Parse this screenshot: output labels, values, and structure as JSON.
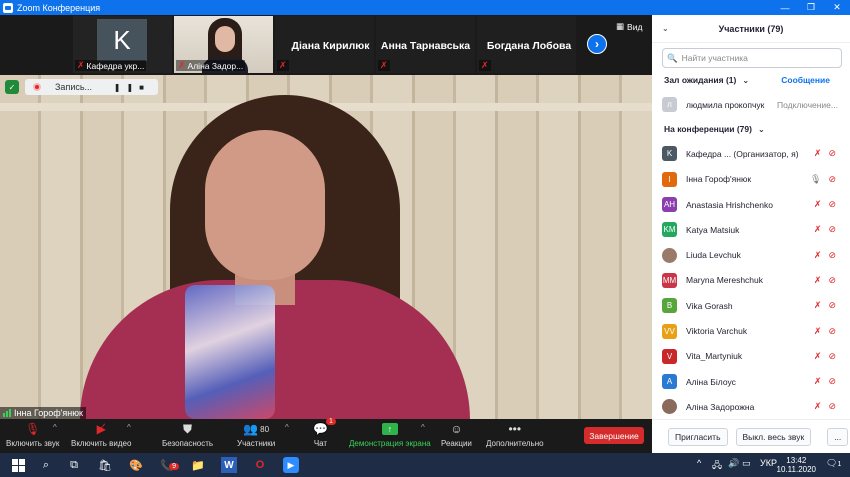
{
  "window": {
    "title": "Zoom Конференция",
    "ctrls": [
      "—",
      "❐",
      "✕"
    ]
  },
  "strip": {
    "thumbs": [
      {
        "name": "Кафедра укр...",
        "initial": "K"
      },
      {
        "name": "Аліна Задор..."
      }
    ],
    "names": [
      "Діана Кирилюк",
      "Анна Тарнавська",
      "Богдана Лобова"
    ],
    "view_label": "Вид"
  },
  "main": {
    "recording_label": "Запись...",
    "speaker_name": "Інна Гороф'янюк"
  },
  "toolbar": {
    "mute": "Включить звук",
    "video": "Включить видео",
    "security": "Безопасность",
    "participants": "Участники",
    "participants_count": "80",
    "chat": "Чат",
    "chat_badge": "1",
    "share": "Демонстрация экрана",
    "reactions": "Реакции",
    "more": "Дополнительно",
    "end": "Завершение"
  },
  "panel": {
    "title": "Участники (79)",
    "search_placeholder": "Найти участника",
    "waiting_label": "Зал ожидания (1)",
    "waiting_action": "Сообщение",
    "waiting_person": {
      "name": "людмила прокопчук",
      "status": "Подключение...",
      "initial": "л"
    },
    "in_conf_label": "На конференции (79)",
    "participants": [
      {
        "name": "Кафедра ... (Организатор, я)",
        "initial": "K",
        "color": "#4a5964"
      },
      {
        "name": "Інна Гороф'янюк",
        "initial": "І",
        "color": "#e2680e"
      },
      {
        "name": "Anastasia Hrishchenko",
        "initial": "AH",
        "color": "#8b3fae"
      },
      {
        "name": "Katya Matsiuk",
        "initial": "KM",
        "color": "#24a861"
      },
      {
        "name": "Liuda Levchuk",
        "initial": "",
        "color": "#9a7a6a"
      },
      {
        "name": "Maryna Mereshchuk",
        "initial": "MM",
        "color": "#c9364a"
      },
      {
        "name": "Vika Gorash",
        "initial": "B",
        "color": "#57a63c"
      },
      {
        "name": "Viktoria Varchuk",
        "initial": "VV",
        "color": "#e8a117"
      },
      {
        "name": "Vita_Martyniuk",
        "initial": "V",
        "color": "#c8282a"
      },
      {
        "name": "Аліна Білоус",
        "initial": "A",
        "color": "#2a7ad4"
      },
      {
        "name": "Аліна Задорожна",
        "initial": "",
        "color": "#8a6a5a"
      }
    ],
    "footer": {
      "invite": "Пригласить",
      "mute_all": "Выкл. весь звук",
      "more": "..."
    }
  },
  "taskbar": {
    "lang": "УКР",
    "time": "13:42",
    "date": "10.11.2020",
    "notify": "1",
    "viber_badge": "9"
  }
}
